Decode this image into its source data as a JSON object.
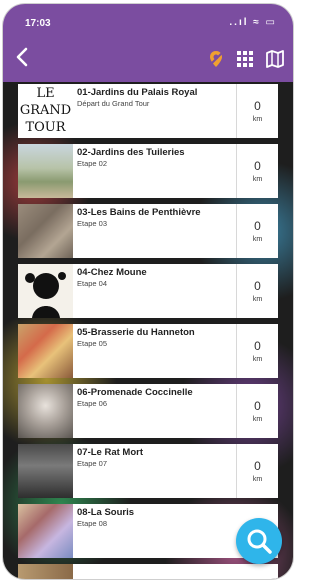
{
  "status_bar": {
    "time": "17:03",
    "icons": "..ıl ≈ ▭"
  },
  "toolbar": {
    "back_icon": "chevron-left-icon",
    "icons": [
      "location-pin-icon",
      "grid-icon",
      "map-icon"
    ]
  },
  "steps": [
    {
      "title": "01-Jardins du Palais Royal",
      "subtitle": "Départ du Grand Tour",
      "distance": "0",
      "unit": "km",
      "thumb_text": [
        "LE",
        "GRAND",
        "TOUR"
      ]
    },
    {
      "title": "02-Jardins des Tuileries",
      "subtitle": "Etape 02",
      "distance": "0",
      "unit": "km"
    },
    {
      "title": "03-Les Bains de Penthièvre",
      "subtitle": "Etape 03",
      "distance": "0",
      "unit": "km"
    },
    {
      "title": "04-Chez Moune",
      "subtitle": "Etape 04",
      "distance": "0",
      "unit": "km"
    },
    {
      "title": "05-Brasserie du Hanneton",
      "subtitle": "Etape 05",
      "distance": "0",
      "unit": "km"
    },
    {
      "title": "06-Promenade Coccinelle",
      "subtitle": "Etape 06",
      "distance": "0",
      "unit": "km"
    },
    {
      "title": "07-Le Rat Mort",
      "subtitle": "Etape 07",
      "distance": "0",
      "unit": "km"
    },
    {
      "title": "08-La Souris",
      "subtitle": "Etape 08",
      "distance": "0",
      "unit": "km"
    }
  ],
  "fab": {
    "icon": "search-icon",
    "color": "#2fb5ea"
  },
  "colors": {
    "header": "#7b4da0",
    "accent_pin": "#f0a030"
  }
}
